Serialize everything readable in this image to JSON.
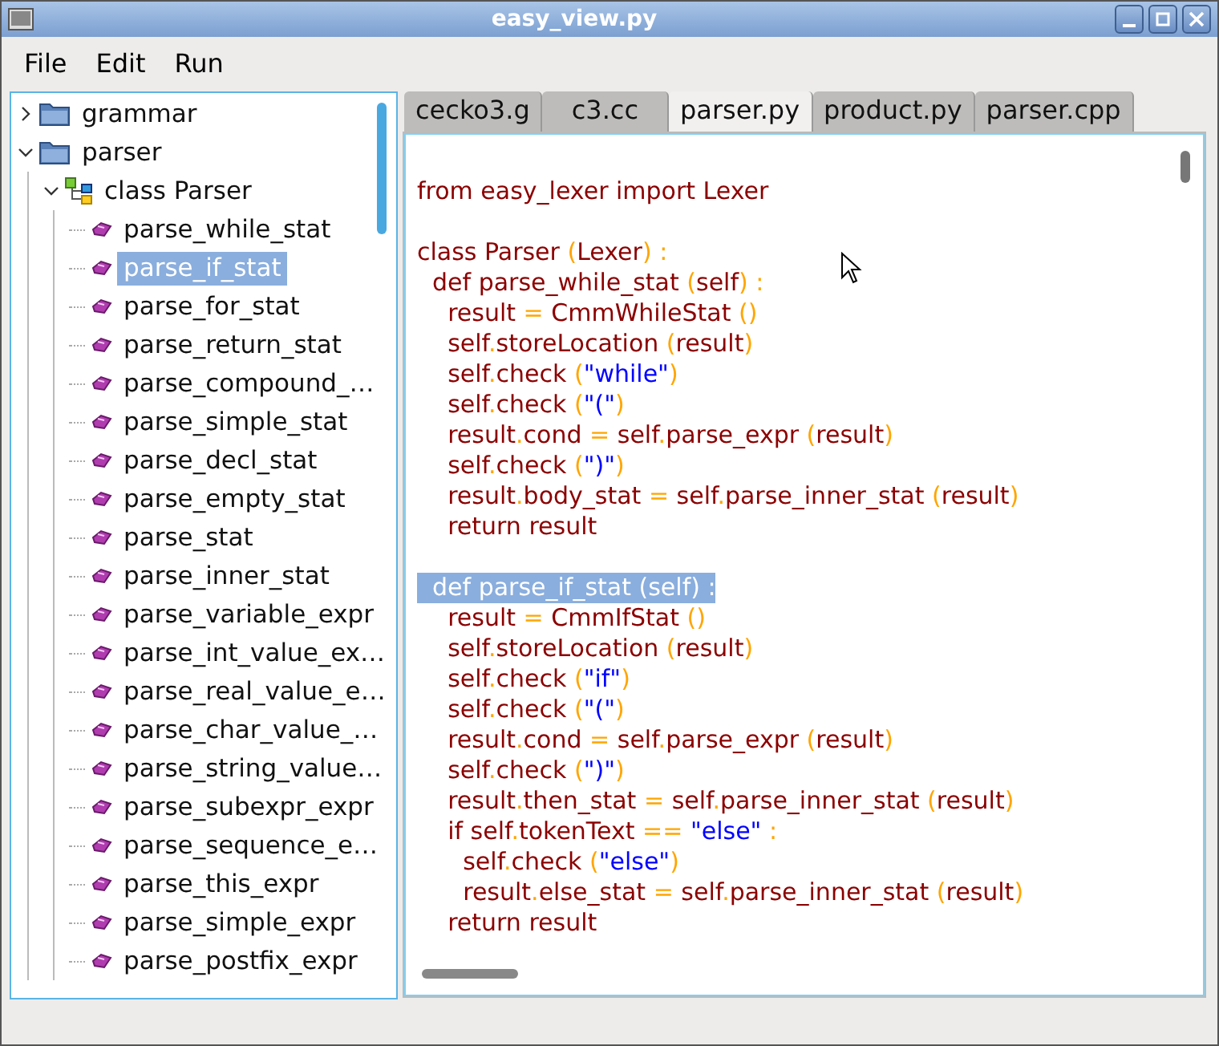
{
  "window": {
    "title": "easy_view.py"
  },
  "menu": [
    "File",
    "Edit",
    "Run"
  ],
  "tree": [
    {
      "label": "grammar",
      "kind": "folder",
      "expanded": false,
      "selected": false
    },
    {
      "label": "parser",
      "kind": "folder",
      "expanded": true,
      "selected": false,
      "children": [
        {
          "label": "class Parser",
          "kind": "class",
          "expanded": true,
          "selected": false,
          "children": [
            {
              "label": "parse_while_stat",
              "kind": "method",
              "selected": false
            },
            {
              "label": "parse_if_stat",
              "kind": "method",
              "selected": true
            },
            {
              "label": "parse_for_stat",
              "kind": "method",
              "selected": false
            },
            {
              "label": "parse_return_stat",
              "kind": "method",
              "selected": false
            },
            {
              "label": "parse_compound_…",
              "kind": "method",
              "selected": false
            },
            {
              "label": "parse_simple_stat",
              "kind": "method",
              "selected": false
            },
            {
              "label": "parse_decl_stat",
              "kind": "method",
              "selected": false
            },
            {
              "label": "parse_empty_stat",
              "kind": "method",
              "selected": false
            },
            {
              "label": "parse_stat",
              "kind": "method",
              "selected": false
            },
            {
              "label": "parse_inner_stat",
              "kind": "method",
              "selected": false
            },
            {
              "label": "parse_variable_expr",
              "kind": "method",
              "selected": false
            },
            {
              "label": "parse_int_value_ex…",
              "kind": "method",
              "selected": false
            },
            {
              "label": "parse_real_value_e…",
              "kind": "method",
              "selected": false
            },
            {
              "label": "parse_char_value_…",
              "kind": "method",
              "selected": false
            },
            {
              "label": "parse_string_value…",
              "kind": "method",
              "selected": false
            },
            {
              "label": "parse_subexpr_expr",
              "kind": "method",
              "selected": false
            },
            {
              "label": "parse_sequence_e…",
              "kind": "method",
              "selected": false
            },
            {
              "label": "parse_this_expr",
              "kind": "method",
              "selected": false
            },
            {
              "label": "parse_simple_expr",
              "kind": "method",
              "selected": false
            },
            {
              "label": "parse_postfix_expr",
              "kind": "method",
              "selected": false
            }
          ]
        }
      ]
    }
  ],
  "tabs": [
    {
      "label": "cecko3.g",
      "selected": false
    },
    {
      "label": "c3.cc",
      "selected": false
    },
    {
      "label": "parser.py",
      "selected": true
    },
    {
      "label": "product.py",
      "selected": false
    },
    {
      "label": "parser.cpp",
      "selected": false
    }
  ],
  "code": [
    {
      "kind": "blank"
    },
    {
      "kind": "code",
      "selected": false,
      "tokens": [
        {
          "t": "from easy_lexer import Lexer",
          "kind": "id"
        }
      ]
    },
    {
      "kind": "blank"
    },
    {
      "kind": "code",
      "selected": false,
      "tokens": [
        {
          "t": "class Parser ",
          "kind": "id"
        },
        {
          "t": "(",
          "kind": "op"
        },
        {
          "t": "Lexer",
          "kind": "id"
        },
        {
          "t": ") :",
          "kind": "op"
        }
      ]
    },
    {
      "kind": "code",
      "selected": false,
      "tokens": [
        {
          "t": "  def parse_while_stat ",
          "kind": "id"
        },
        {
          "t": "(",
          "kind": "op"
        },
        {
          "t": "self",
          "kind": "id"
        },
        {
          "t": ") :",
          "kind": "op"
        }
      ]
    },
    {
      "kind": "code",
      "selected": false,
      "tokens": [
        {
          "t": "    result ",
          "kind": "id"
        },
        {
          "t": "=",
          "kind": "op"
        },
        {
          "t": " CmmWhileStat ",
          "kind": "id"
        },
        {
          "t": "()",
          "kind": "op"
        }
      ]
    },
    {
      "kind": "code",
      "selected": false,
      "tokens": [
        {
          "t": "    self",
          "kind": "id"
        },
        {
          "t": ".",
          "kind": "op"
        },
        {
          "t": "storeLocation ",
          "kind": "id"
        },
        {
          "t": "(",
          "kind": "op"
        },
        {
          "t": "result",
          "kind": "id"
        },
        {
          "t": ")",
          "kind": "op"
        }
      ]
    },
    {
      "kind": "code",
      "selected": false,
      "tokens": [
        {
          "t": "    self",
          "kind": "id"
        },
        {
          "t": ".",
          "kind": "op"
        },
        {
          "t": "check ",
          "kind": "id"
        },
        {
          "t": "(",
          "kind": "op"
        },
        {
          "t": "\"while\"",
          "kind": "str"
        },
        {
          "t": ")",
          "kind": "op"
        }
      ]
    },
    {
      "kind": "code",
      "selected": false,
      "tokens": [
        {
          "t": "    self",
          "kind": "id"
        },
        {
          "t": ".",
          "kind": "op"
        },
        {
          "t": "check ",
          "kind": "id"
        },
        {
          "t": "(",
          "kind": "op"
        },
        {
          "t": "\"(\"",
          "kind": "str"
        },
        {
          "t": ")",
          "kind": "op"
        }
      ]
    },
    {
      "kind": "code",
      "selected": false,
      "tokens": [
        {
          "t": "    result",
          "kind": "id"
        },
        {
          "t": ".",
          "kind": "op"
        },
        {
          "t": "cond ",
          "kind": "id"
        },
        {
          "t": "=",
          "kind": "op"
        },
        {
          "t": " self",
          "kind": "id"
        },
        {
          "t": ".",
          "kind": "op"
        },
        {
          "t": "parse_expr ",
          "kind": "id"
        },
        {
          "t": "(",
          "kind": "op"
        },
        {
          "t": "result",
          "kind": "id"
        },
        {
          "t": ")",
          "kind": "op"
        }
      ]
    },
    {
      "kind": "code",
      "selected": false,
      "tokens": [
        {
          "t": "    self",
          "kind": "id"
        },
        {
          "t": ".",
          "kind": "op"
        },
        {
          "t": "check ",
          "kind": "id"
        },
        {
          "t": "(",
          "kind": "op"
        },
        {
          "t": "\")\"",
          "kind": "str"
        },
        {
          "t": ")",
          "kind": "op"
        }
      ]
    },
    {
      "kind": "code",
      "selected": false,
      "tokens": [
        {
          "t": "    result",
          "kind": "id"
        },
        {
          "t": ".",
          "kind": "op"
        },
        {
          "t": "body_stat ",
          "kind": "id"
        },
        {
          "t": "=",
          "kind": "op"
        },
        {
          "t": " self",
          "kind": "id"
        },
        {
          "t": ".",
          "kind": "op"
        },
        {
          "t": "parse_inner_stat ",
          "kind": "id"
        },
        {
          "t": "(",
          "kind": "op"
        },
        {
          "t": "result",
          "kind": "id"
        },
        {
          "t": ")",
          "kind": "op"
        }
      ]
    },
    {
      "kind": "code",
      "selected": false,
      "tokens": [
        {
          "t": "    return result",
          "kind": "id"
        }
      ]
    },
    {
      "kind": "blank"
    },
    {
      "kind": "code",
      "selected": true,
      "tokens": [
        {
          "t": "  def parse_if_stat ",
          "kind": "id"
        },
        {
          "t": "(",
          "kind": "op"
        },
        {
          "t": "self",
          "kind": "id"
        },
        {
          "t": ") :",
          "kind": "op"
        }
      ]
    },
    {
      "kind": "code",
      "selected": false,
      "tokens": [
        {
          "t": "    result ",
          "kind": "id"
        },
        {
          "t": "=",
          "kind": "op"
        },
        {
          "t": " CmmIfStat ",
          "kind": "id"
        },
        {
          "t": "()",
          "kind": "op"
        }
      ]
    },
    {
      "kind": "code",
      "selected": false,
      "tokens": [
        {
          "t": "    self",
          "kind": "id"
        },
        {
          "t": ".",
          "kind": "op"
        },
        {
          "t": "storeLocation ",
          "kind": "id"
        },
        {
          "t": "(",
          "kind": "op"
        },
        {
          "t": "result",
          "kind": "id"
        },
        {
          "t": ")",
          "kind": "op"
        }
      ]
    },
    {
      "kind": "code",
      "selected": false,
      "tokens": [
        {
          "t": "    self",
          "kind": "id"
        },
        {
          "t": ".",
          "kind": "op"
        },
        {
          "t": "check ",
          "kind": "id"
        },
        {
          "t": "(",
          "kind": "op"
        },
        {
          "t": "\"if\"",
          "kind": "str"
        },
        {
          "t": ")",
          "kind": "op"
        }
      ]
    },
    {
      "kind": "code",
      "selected": false,
      "tokens": [
        {
          "t": "    self",
          "kind": "id"
        },
        {
          "t": ".",
          "kind": "op"
        },
        {
          "t": "check ",
          "kind": "id"
        },
        {
          "t": "(",
          "kind": "op"
        },
        {
          "t": "\"(\"",
          "kind": "str"
        },
        {
          "t": ")",
          "kind": "op"
        }
      ]
    },
    {
      "kind": "code",
      "selected": false,
      "tokens": [
        {
          "t": "    result",
          "kind": "id"
        },
        {
          "t": ".",
          "kind": "op"
        },
        {
          "t": "cond ",
          "kind": "id"
        },
        {
          "t": "=",
          "kind": "op"
        },
        {
          "t": " self",
          "kind": "id"
        },
        {
          "t": ".",
          "kind": "op"
        },
        {
          "t": "parse_expr ",
          "kind": "id"
        },
        {
          "t": "(",
          "kind": "op"
        },
        {
          "t": "result",
          "kind": "id"
        },
        {
          "t": ")",
          "kind": "op"
        }
      ]
    },
    {
      "kind": "code",
      "selected": false,
      "tokens": [
        {
          "t": "    self",
          "kind": "id"
        },
        {
          "t": ".",
          "kind": "op"
        },
        {
          "t": "check ",
          "kind": "id"
        },
        {
          "t": "(",
          "kind": "op"
        },
        {
          "t": "\")\"",
          "kind": "str"
        },
        {
          "t": ")",
          "kind": "op"
        }
      ]
    },
    {
      "kind": "code",
      "selected": false,
      "tokens": [
        {
          "t": "    result",
          "kind": "id"
        },
        {
          "t": ".",
          "kind": "op"
        },
        {
          "t": "then_stat ",
          "kind": "id"
        },
        {
          "t": "=",
          "kind": "op"
        },
        {
          "t": " self",
          "kind": "id"
        },
        {
          "t": ".",
          "kind": "op"
        },
        {
          "t": "parse_inner_stat ",
          "kind": "id"
        },
        {
          "t": "(",
          "kind": "op"
        },
        {
          "t": "result",
          "kind": "id"
        },
        {
          "t": ")",
          "kind": "op"
        }
      ]
    },
    {
      "kind": "code",
      "selected": false,
      "tokens": [
        {
          "t": "    if self",
          "kind": "id"
        },
        {
          "t": ".",
          "kind": "op"
        },
        {
          "t": "tokenText ",
          "kind": "id"
        },
        {
          "t": "==",
          "kind": "op"
        },
        {
          "t": " \"else\"",
          "kind": "str"
        },
        {
          "t": " :",
          "kind": "op"
        }
      ]
    },
    {
      "kind": "code",
      "selected": false,
      "tokens": [
        {
          "t": "      self",
          "kind": "id"
        },
        {
          "t": ".",
          "kind": "op"
        },
        {
          "t": "check ",
          "kind": "id"
        },
        {
          "t": "(",
          "kind": "op"
        },
        {
          "t": "\"else\"",
          "kind": "str"
        },
        {
          "t": ")",
          "kind": "op"
        }
      ]
    },
    {
      "kind": "code",
      "selected": false,
      "tokens": [
        {
          "t": "      result",
          "kind": "id"
        },
        {
          "t": ".",
          "kind": "op"
        },
        {
          "t": "else_stat ",
          "kind": "id"
        },
        {
          "t": "=",
          "kind": "op"
        },
        {
          "t": " self",
          "kind": "id"
        },
        {
          "t": ".",
          "kind": "op"
        },
        {
          "t": "parse_inner_stat ",
          "kind": "id"
        },
        {
          "t": "(",
          "kind": "op"
        },
        {
          "t": "result",
          "kind": "id"
        },
        {
          "t": ")",
          "kind": "op"
        }
      ]
    },
    {
      "kind": "code",
      "selected": false,
      "tokens": [
        {
          "t": "    return result",
          "kind": "id"
        }
      ]
    }
  ]
}
